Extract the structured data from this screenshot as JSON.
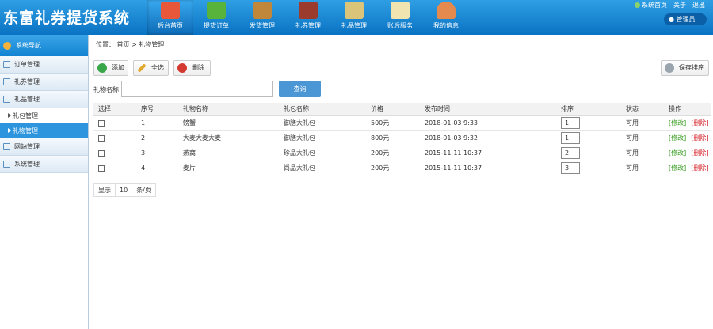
{
  "app": {
    "title": "东富礼券提货系统"
  },
  "nav": [
    {
      "label": "后台首页",
      "icon": "home-icon",
      "color": "#e8573a"
    },
    {
      "label": "提货订单",
      "icon": "cart-icon",
      "color": "#58b33c"
    },
    {
      "label": "发货管理",
      "icon": "box-icon",
      "color": "#c0873b"
    },
    {
      "label": "礼券管理",
      "icon": "book-icon",
      "color": "#9b3b2e"
    },
    {
      "label": "礼品管理",
      "icon": "gift-icon",
      "color": "#d9c47a"
    },
    {
      "label": "账后服务",
      "icon": "note-icon",
      "color": "#f0e4b0"
    },
    {
      "label": "我的信息",
      "icon": "user-icon",
      "color": "#e58a4e"
    }
  ],
  "toplinks": {
    "home": "系统首页",
    "about": "关于",
    "logout": "退出"
  },
  "admin": {
    "label": "管理员"
  },
  "sidebar": {
    "title": "系统导航",
    "groups": [
      {
        "label": "订单管理",
        "icon": "list-icon"
      },
      {
        "label": "礼券管理",
        "icon": "edit-icon"
      },
      {
        "label": "礼品管理",
        "icon": "grid-icon"
      }
    ],
    "subitems": [
      {
        "label": "礼包管理"
      },
      {
        "label": "礼物管理"
      }
    ],
    "groups2": [
      {
        "label": "网站管理",
        "icon": "window-icon"
      },
      {
        "label": "系统管理",
        "icon": "settings-icon"
      }
    ]
  },
  "breadcrumb": {
    "prefix": "位置：",
    "home": "首页",
    "sep": ">",
    "current": "礼物管理"
  },
  "toolbar": {
    "add": "添加",
    "select_all": "全选",
    "delete": "删除",
    "save_sort": "保存排序"
  },
  "search": {
    "label": "礼物名称",
    "value": "",
    "button": "查询"
  },
  "table": {
    "headers": [
      "选择",
      "序号",
      "礼物名称",
      "礼包名称",
      "价格",
      "发布时间",
      "排序",
      "状态",
      "操作"
    ],
    "rows": [
      {
        "no": "1",
        "name": "螃蟹",
        "package": "御膳大礼包",
        "price": "500元",
        "time": "2018-01-03 9:33",
        "sort": "1",
        "status": "可用"
      },
      {
        "no": "2",
        "name": "大麦大麦大麦",
        "package": "御膳大礼包",
        "price": "800元",
        "time": "2018-01-03 9:32",
        "sort": "1",
        "status": "可用"
      },
      {
        "no": "3",
        "name": "燕窝",
        "package": "珍品大礼包",
        "price": "200元",
        "time": "2015-11-11 10:37",
        "sort": "2",
        "status": "可用"
      },
      {
        "no": "4",
        "name": "麦片",
        "package": "尚品大礼包",
        "price": "200元",
        "time": "2015-11-11 10:37",
        "sort": "3",
        "status": "可用"
      }
    ],
    "edit_label": "[修改]",
    "delete_label": "[删除]"
  },
  "pager": {
    "show": "显示",
    "size": "10",
    "unit": "条/页"
  }
}
